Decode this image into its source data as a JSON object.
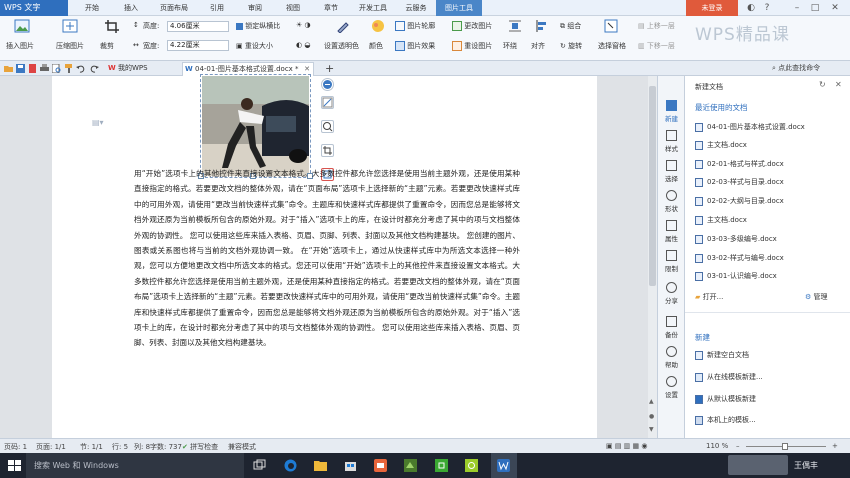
{
  "titlebar": {
    "app_label": "WPS 文字",
    "menu": [
      "开始",
      "插入",
      "页面布局",
      "引用",
      "审阅",
      "视图",
      "章节",
      "开发工具",
      "云服务",
      "图片工具"
    ],
    "active_menu_index": 9,
    "login_label": "未登录"
  },
  "ribbon": {
    "insert_pic": "插入图片",
    "compress_pic": "压缩图片",
    "crop": "裁剪",
    "rotate": "旋转",
    "height_label": "高度:",
    "height_value": "4.06厘米",
    "width_label": "宽度:",
    "width_value": "4.22厘米",
    "lock_ratio": "锁定纵横比",
    "reset_size": "重设大小",
    "set_transparent": "设置透明色",
    "color": "颜色",
    "pic_outline": "图片轮廓",
    "pic_effect": "图片效果",
    "change_pic": "更改图片",
    "reset_pic": "重设图片",
    "wrap": "环绕",
    "align": "对齐",
    "group": "组合",
    "rotate2": "旋转",
    "select_pane": "选择窗格",
    "bring_up": "上移一层",
    "send_down": "下移一层",
    "brand": "WPS精品课"
  },
  "tabs": {
    "my_wps": "我的WPS",
    "doc_tab": "04-01-图片基本格式设置.docx *",
    "search_hint": "点此查找命令"
  },
  "document": {
    "paragraph": "用“开始”选项卡上的其他控件来直接设置文本格式。大多数控件都允许您选择是使用当前主题外观，还是使用某种直接指定的格式。若要更改文档的整体外观，请在“页面布局”选项卡上选择新的“主题”元素。若要更改快速样式库中的可用外观，请使用“更改当前快速样式集”命令。主题库和快速样式库都提供了重置命令，因而您总是能够将文档外观还原为当前模板所包含的原始外观。对于“插入”选项卡上的库，在设计时都充分考虑了其中的项与文档整体外观的协调性。 您可以使用这些库来插入表格、页眉、页脚、列表、封面以及其他文档构建基块。 您创建的图片、图表或关系图也将与当前的文档外观协调一致。 在“开始”选项卡上，通过从快速样式库中为所选文本选择一种外观，您可以方便地更改文档中所选文本的格式。您还可以使用“开始”选项卡上的其他控件来直接设置文本格式。大多数控件都允许您选择是使用当前主题外观，还是使用某种直接指定的格式。若要更改文档的整体外观，请在“页面布局”选项卡上选择新的“主题”元素。若要更改快速样式库中的可用外观，请使用“更改当前快速样式集”命令。主题库和快速样式库都提供了重置命令，因而您总是能够将文档外观还原为当前模板所包含的原始外观。对于“插入”选项卡上的库，在设计时都充分考虑了其中的项与文档整体外观的协调性。 您可以使用这些库来插入表格、页眉、页脚、列表、封面以及其他文档构建基块。"
  },
  "rail": [
    "新建",
    "样式",
    "选择",
    "形状",
    "属性",
    "限制",
    "分享",
    "备份",
    "帮助",
    "设置"
  ],
  "pane": {
    "header": "新建文档",
    "recent_title": "最近使用的文档",
    "recent": [
      "04-01-图片基本格式设置.docx",
      "主文档.docx",
      "02-01-格式与样式.docx",
      "02-03-样式与目录.docx",
      "02-02-大纲与目录.docx",
      "主文档.docx",
      "03-03-多级编号.docx",
      "03-02-样式与编号.docx",
      "03-01-认识编号.docx"
    ],
    "open": "打开...",
    "manage": "管理",
    "new_title": "新建",
    "new_items": [
      "新建空白文档",
      "从在线模板新建...",
      "从默认模板新建",
      "本机上的模板..."
    ]
  },
  "status": {
    "page": "页码: 1",
    "pages": "页面: 1/1",
    "section": "节: 1/1",
    "row": "行: 5",
    "col": "列: 8",
    "words": "字数: 737",
    "spell": "拼写检查",
    "mode": "兼容模式",
    "zoom": "110 %"
  },
  "taskbar": {
    "search": "搜索 Web 和 Windows",
    "user": "王偶丰"
  }
}
